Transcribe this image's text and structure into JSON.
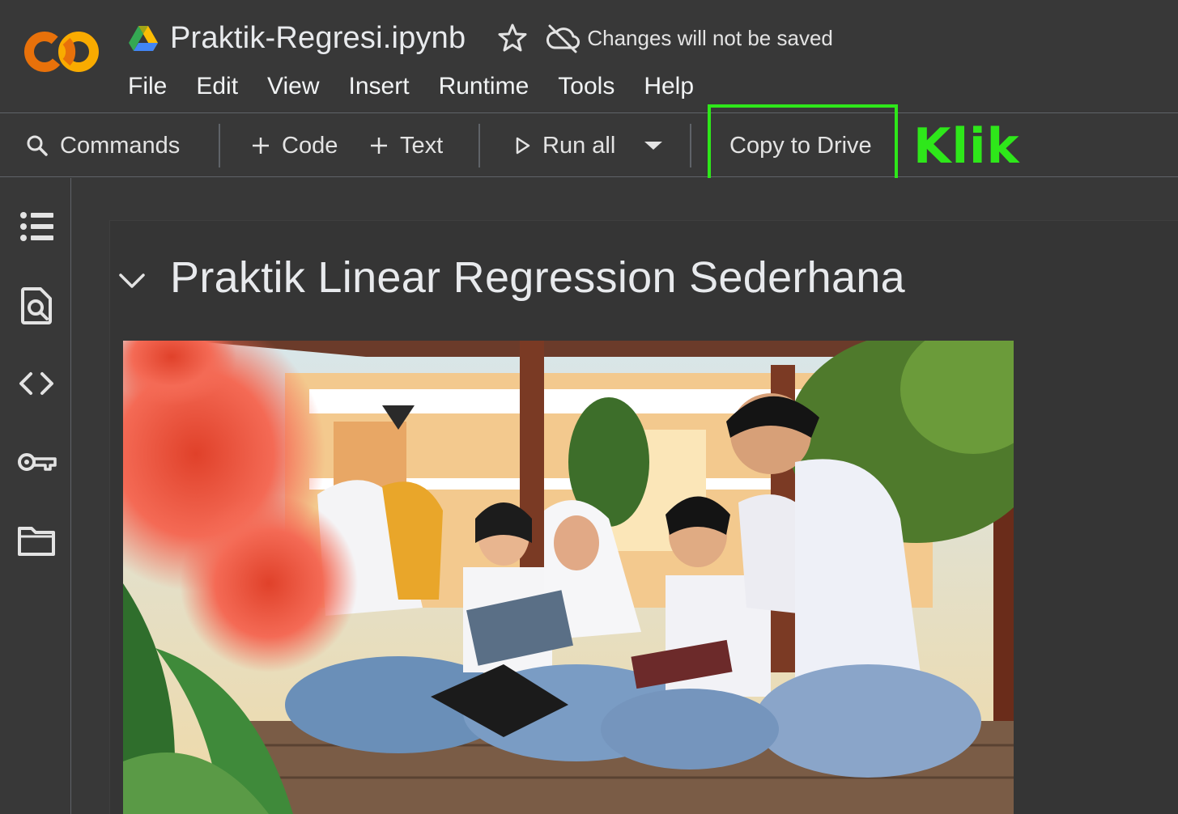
{
  "app": {
    "logo": "colab-logo",
    "notebook_title": "Praktik-Regresi.ipynb",
    "save_status": "Changes will not be saved"
  },
  "menu": {
    "items": [
      "File",
      "Edit",
      "View",
      "Insert",
      "Runtime",
      "Tools",
      "Help"
    ]
  },
  "toolbar": {
    "commands_label": "Commands",
    "code_label": "Code",
    "text_label": "Text",
    "run_all_label": "Run all",
    "copy_label": "Copy to Drive"
  },
  "annotation": {
    "label": "Klik",
    "color": "#2ee71a"
  },
  "sidebar": {
    "icons": [
      "toc-icon",
      "find-icon",
      "code-snippets-icon",
      "secrets-key-icon",
      "folder-icon"
    ]
  },
  "notebook": {
    "heading": "Praktik Linear Regression Sederhana",
    "image": "photo of students reading books in a gazebo"
  },
  "colors": {
    "background": "#383838",
    "logo_orange": "#f9ab00",
    "logo_orange_dark": "#e8710a",
    "highlight": "#2ee71a"
  }
}
